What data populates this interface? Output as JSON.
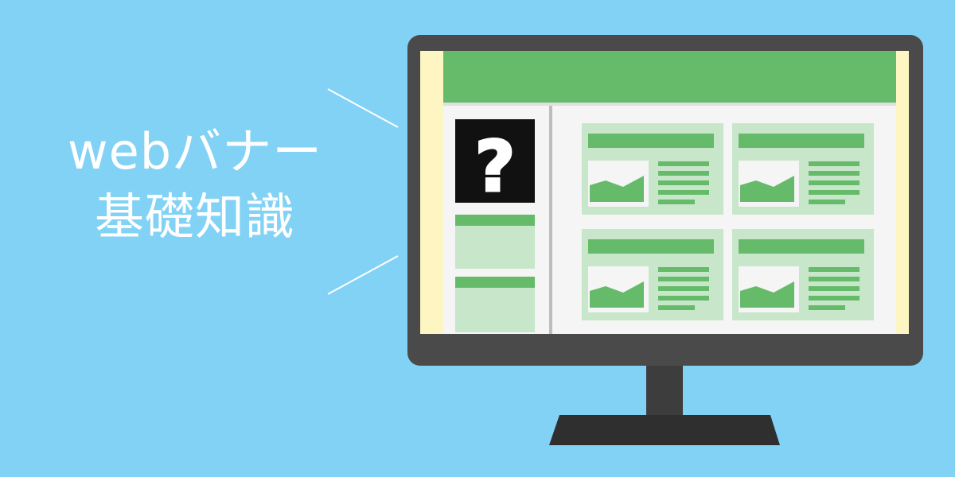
{
  "banner": {
    "title_line1": "webバナー",
    "title_line2": "基礎知識"
  },
  "illustration": {
    "subject": "desktop-monitor",
    "screen_content": "website-layout-with-question-mark",
    "question_mark": "?"
  },
  "colors": {
    "background": "#82d2f6",
    "monitor_frame": "#4a4a4a",
    "monitor_stand": "#3d3d3d",
    "screen_side": "#fdf5c2",
    "screen_header": "#66bb6a",
    "panel": "#c8e6c9",
    "panel_bar": "#66bb6a",
    "text": "#ffffff"
  }
}
